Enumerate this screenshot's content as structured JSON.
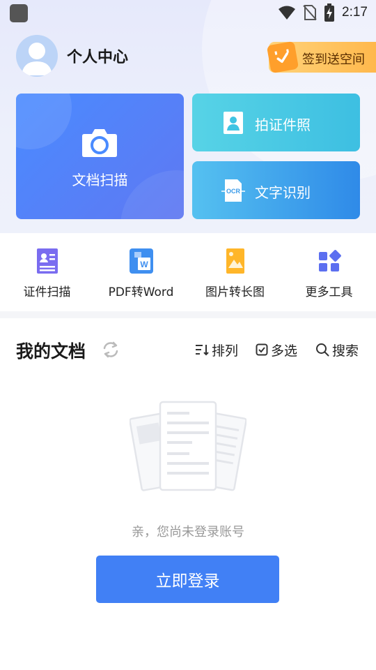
{
  "status_bar": {
    "time": "2:17"
  },
  "header": {
    "title": "个人中心",
    "signin_label": "签到送空间"
  },
  "cards": {
    "scan": {
      "label": "文档扫描"
    },
    "id_photo": {
      "label": "拍证件照"
    },
    "ocr": {
      "label": "文字识别",
      "icon_text": "OCR"
    }
  },
  "tools": [
    {
      "label": "证件扫描"
    },
    {
      "label": "PDF转Word",
      "icon_text": "W"
    },
    {
      "label": "图片转长图"
    },
    {
      "label": "更多工具"
    }
  ],
  "docs": {
    "title": "我的文档",
    "sort_label": "排列",
    "multi_label": "多选",
    "search_label": "搜索",
    "empty_text": "亲，您尚未登录账号",
    "login_label": "立即登录"
  },
  "colors": {
    "primary": "#4180f5",
    "scan_card": "#5a82f5",
    "id_card": "#4ac9e4",
    "ocr_card": "#3f9fec",
    "badge": "#ffc45e"
  }
}
